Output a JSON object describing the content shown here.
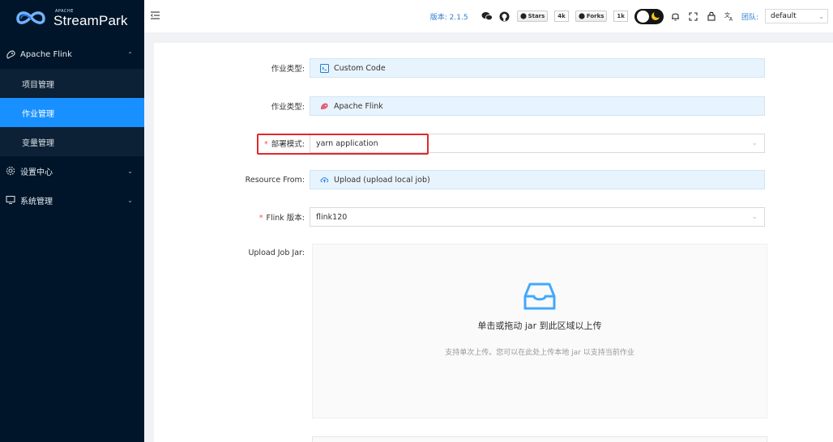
{
  "app": {
    "logo_apache": "APACHE",
    "logo_name": "StreamPark"
  },
  "sidebar": {
    "groups": [
      {
        "label": "Apache Flink",
        "icon": "flink-icon",
        "expanded": true,
        "items": [
          {
            "label": "项目管理",
            "active": false
          },
          {
            "label": "作业管理",
            "active": true
          },
          {
            "label": "变量管理",
            "active": false
          }
        ]
      },
      {
        "label": "设置中心",
        "icon": "gear-icon",
        "expanded": false
      },
      {
        "label": "系统管理",
        "icon": "monitor-icon",
        "expanded": false
      }
    ]
  },
  "header": {
    "version": "版本: 2.1.5",
    "stars_label": "Stars",
    "stars_count": "4k",
    "forks_label": "Forks",
    "forks_count": "1k",
    "team_label": "团队:",
    "team_value": "default"
  },
  "form": {
    "job_type_label": "作业类型:",
    "job_type_value": "Custom Code",
    "engine_type_label": "作业类型:",
    "engine_type_value": "Apache Flink",
    "deploy_mode_label": "部署模式:",
    "deploy_mode_value": "yarn application",
    "resource_from_label": "Resource From:",
    "resource_from_value": "Upload (upload local job)",
    "flink_version_label": "Flink 版本:",
    "flink_version_value": "flink120",
    "upload_jar_label": "Upload Job Jar:",
    "upload_title": "单击或拖动 jar 到此区域以上传",
    "upload_hint": "支持单次上传。您可以在此处上传本地 jar 以支持当前作业"
  },
  "colors": {
    "sidebar_bg": "#001529",
    "active_item": "#1890ff",
    "highlight_box": "#e0292b",
    "readonly_field": "#e8f4fd"
  }
}
